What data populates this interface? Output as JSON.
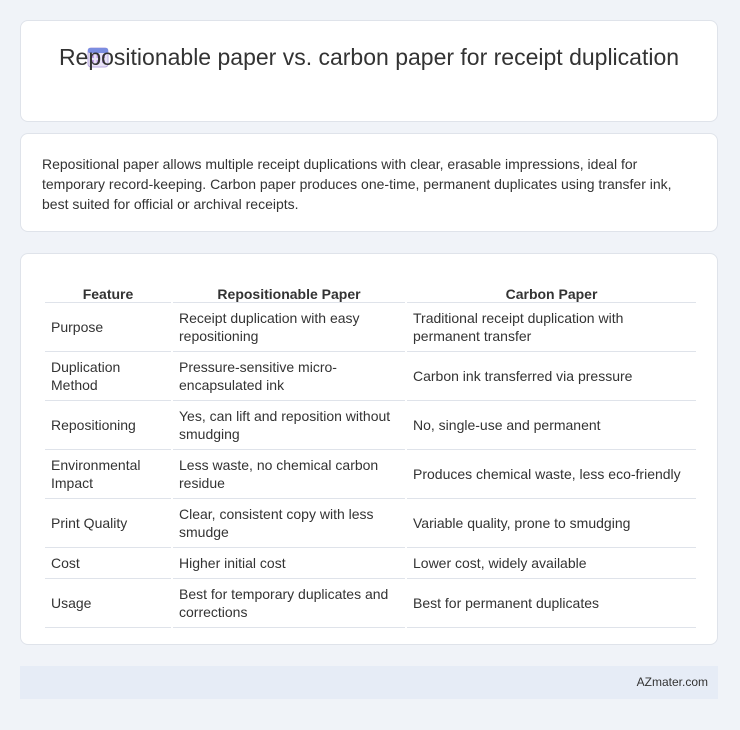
{
  "header": {
    "title": "Repositionable paper vs. carbon paper for receipt duplication",
    "icon": "calendar-icon"
  },
  "summary": "Repositional paper allows multiple receipt duplications with clear, erasable impressions, ideal for temporary record-keeping. Carbon paper produces one-time, permanent duplicates using transfer ink, best suited for official or archival receipts.",
  "table": {
    "headers": [
      "Feature",
      "Repositionable Paper",
      "Carbon Paper"
    ],
    "rows": [
      [
        "Purpose",
        "Receipt duplication with easy repositioning",
        "Traditional receipt duplication with permanent transfer"
      ],
      [
        "Duplication Method",
        "Pressure-sensitive micro-encapsulated ink",
        "Carbon ink transferred via pressure"
      ],
      [
        "Repositioning",
        "Yes, can lift and reposition without smudging",
        "No, single-use and permanent"
      ],
      [
        "Environmental Impact",
        "Less waste, no chemical carbon residue",
        "Produces chemical waste, less eco-friendly"
      ],
      [
        "Print Quality",
        "Clear, consistent copy with less smudge",
        "Variable quality, prone to smudging"
      ],
      [
        "Cost",
        "Higher initial cost",
        "Lower cost, widely available"
      ],
      [
        "Usage",
        "Best for temporary duplicates and corrections",
        "Best for permanent duplicates"
      ]
    ]
  },
  "footer": {
    "brand": "AZmater.com"
  }
}
